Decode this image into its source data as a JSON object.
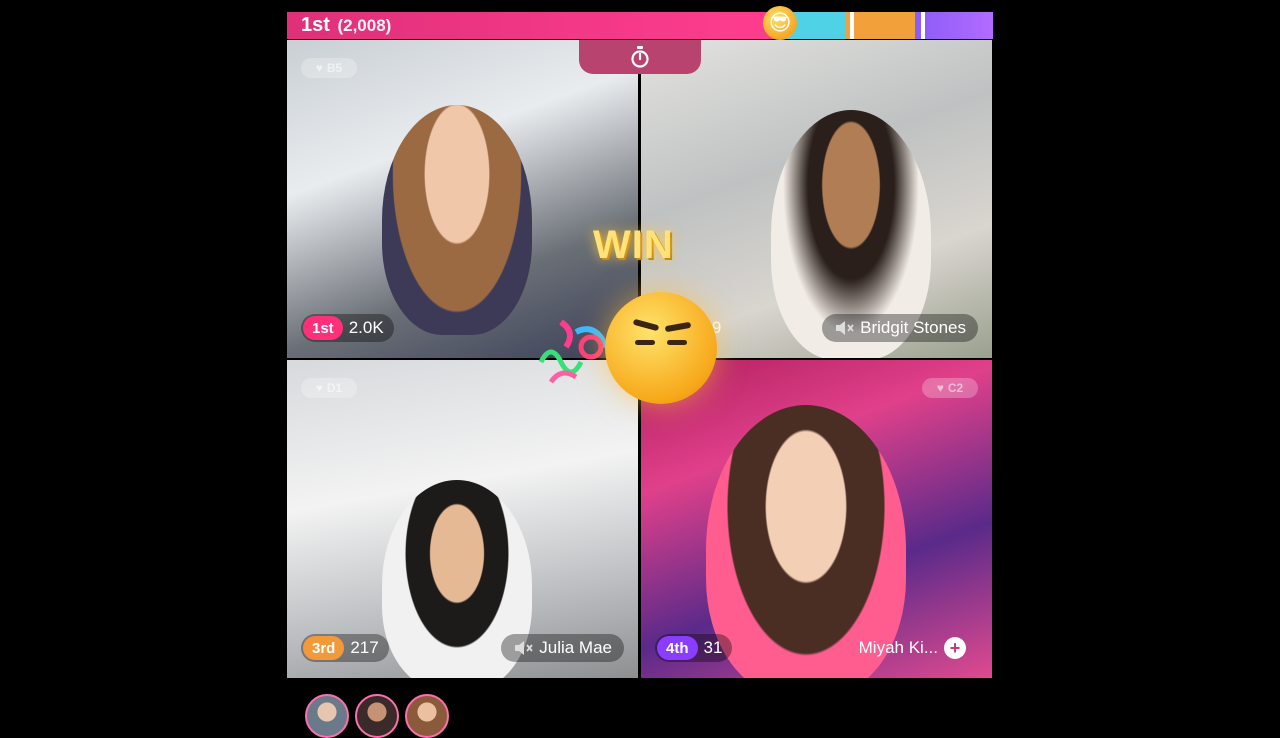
{
  "score_bar": {
    "rank": "1st",
    "points": "(2,008)"
  },
  "timer": {
    "icon": "stopwatch-icon"
  },
  "win_text": "WIN",
  "tiles": [
    {
      "room": "B5",
      "rank": "1st",
      "score": "2.0K",
      "name": "",
      "muted": false
    },
    {
      "room": "",
      "rank": "",
      "score": "219",
      "name": "Bridgit Stones",
      "muted": true
    },
    {
      "room": "D1",
      "rank": "3rd",
      "score": "217",
      "name": "Julia Mae",
      "muted": true
    },
    {
      "room": "C2",
      "rank": "4th",
      "score": "31",
      "name": "Miyah Ki...",
      "muted": false
    }
  ],
  "colors": {
    "rank_1st": "#ff2f79",
    "rank_3rd": "#f2993a",
    "rank_4th": "#8b3dff",
    "bar_pink": "#ff3d8f",
    "bar_cyan": "#4fd2e6",
    "bar_orange": "#f2a03a",
    "bar_purple": "#8a5cf6"
  },
  "viewers": [
    {
      "icon": "viewer-avatar"
    },
    {
      "icon": "viewer-avatar"
    },
    {
      "icon": "viewer-avatar"
    }
  ]
}
